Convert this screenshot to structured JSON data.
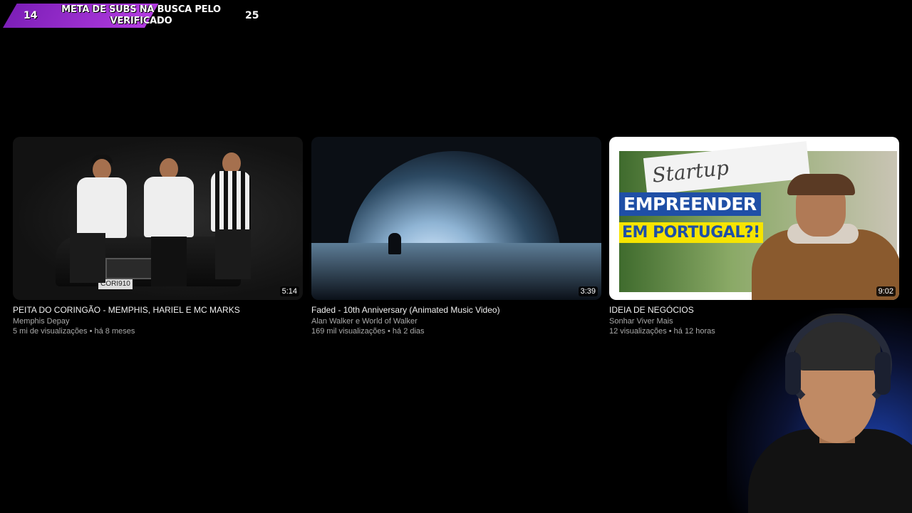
{
  "goal": {
    "current": "14",
    "title": "META DE SUBS NA BUSCA PELO VERIFICADO",
    "target": "25",
    "progress_fraction": 0.56
  },
  "videos": [
    {
      "title": "PEITA DO CORINGÃO - MEMPHIS, HARIEL E MC MARKS",
      "channel": "Memphis Depay",
      "meta": "5 mi de visualizações • há 8 meses",
      "duration": "5:14",
      "plate": "CORI910"
    },
    {
      "title": "Faded - 10th Anniversary (Animated Music Video)",
      "channel": "Alan Walker e World of Walker",
      "meta": "169 mil visualizações • há 2 dias",
      "duration": "3:39"
    },
    {
      "title": "IDEIA DE NEGÓCIOS",
      "channel": "Sonhar Viver Mais",
      "meta": "12 visualizações • há 12 horas",
      "duration": "9:02",
      "thumb_text": {
        "paper": "Startup",
        "line1": "EMPREENDER",
        "line2": "EM PORTUGAL?!"
      }
    }
  ],
  "colors": {
    "goal_bar": "#b23be0",
    "background": "#000000",
    "meta_text": "#aaaaaa"
  }
}
